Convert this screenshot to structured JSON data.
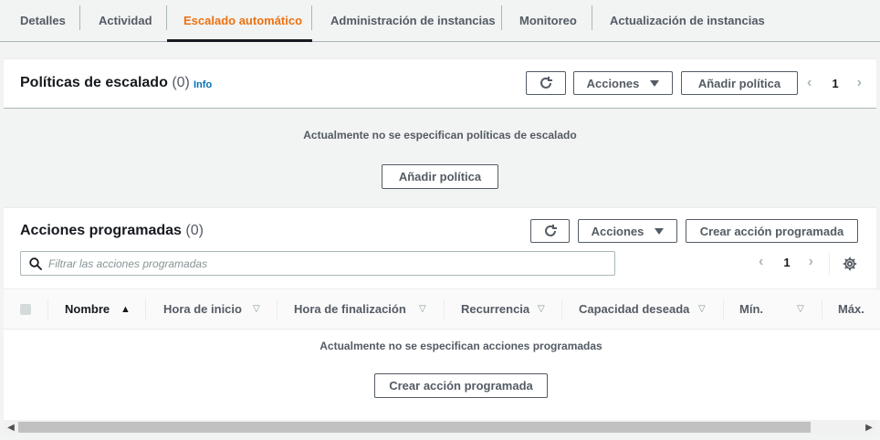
{
  "tabs": [
    {
      "label": "Detalles"
    },
    {
      "label": "Actividad"
    },
    {
      "label": "Escalado automático",
      "active": true
    },
    {
      "label": "Administración de instancias"
    },
    {
      "label": "Monitoreo"
    },
    {
      "label": "Actualización de instancias"
    }
  ],
  "scaling_policies": {
    "title": "Políticas de escalado",
    "count": "(0)",
    "info_label": "Info",
    "actions_label": "Acciones",
    "add_label": "Añadir política",
    "page": "1",
    "empty_message": "Actualmente no se especifican políticas de escalado",
    "empty_add_label": "Añadir política"
  },
  "scheduled_actions": {
    "title": "Acciones programadas",
    "count": "(0)",
    "actions_label": "Acciones",
    "create_label": "Crear acción programada",
    "search_placeholder": "Filtrar las acciones programadas",
    "page": "1",
    "columns": [
      "Nombre",
      "Hora de inicio",
      "Hora de finalización",
      "Recurrencia",
      "Capacidad deseada",
      "Mín.",
      "Máx."
    ],
    "empty_message": "Actualmente no se especifican acciones programadas",
    "empty_create_label": "Crear acción programada"
  },
  "colors": {
    "accent": "#ec7211",
    "link": "#0073bb",
    "text": "#16191f",
    "muted": "#545b64"
  },
  "icons": {
    "refresh": "refresh-icon",
    "settings": "gear-icon",
    "search": "search-icon"
  }
}
